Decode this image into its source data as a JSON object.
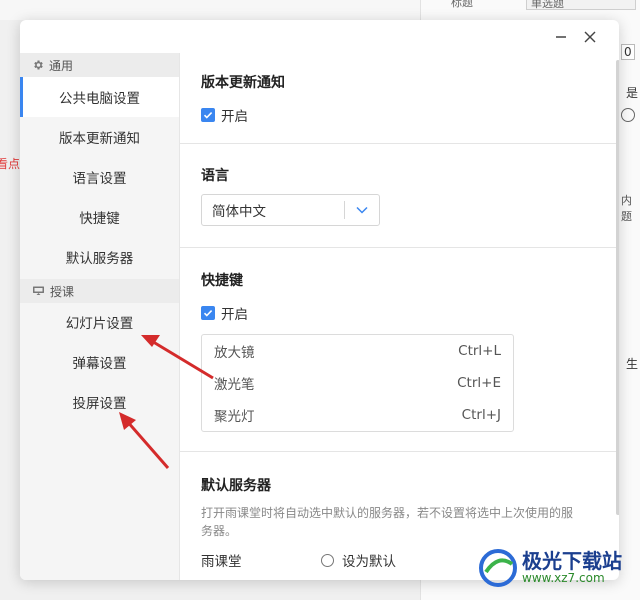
{
  "background_app": {
    "hint_text": "看点",
    "top_label": "标题",
    "top_box": "单选题",
    "spin_value": "0",
    "right_text_1": "是",
    "right_text_2": "内题",
    "right_text_3": "生"
  },
  "dialog": {
    "window": {
      "minimize_symbol": "—",
      "close_symbol": "✕"
    },
    "sidebar": {
      "groups": [
        {
          "header": "通用",
          "icon": "gear-icon",
          "items": [
            "公共电脑设置",
            "版本更新通知",
            "语言设置",
            "快捷键",
            "默认服务器"
          ]
        },
        {
          "header": "授课",
          "icon": "projector-icon",
          "items": [
            "幻灯片设置",
            "弹幕设置",
            "投屏设置"
          ]
        }
      ],
      "active_item": "公共电脑设置"
    },
    "content": {
      "update_notice": {
        "title": "版本更新通知",
        "checkbox_label": "开启",
        "checked": true
      },
      "language": {
        "title": "语言",
        "selected": "简体中文"
      },
      "shortcuts": {
        "title": "快捷键",
        "checkbox_label": "开启",
        "checked": true,
        "rows": [
          {
            "name": "放大镜",
            "key": "Ctrl+L"
          },
          {
            "name": "激光笔",
            "key": "Ctrl+E"
          },
          {
            "name": "聚光灯",
            "key": "Ctrl+J"
          }
        ]
      },
      "default_server": {
        "title": "默认服务器",
        "description": "打开雨课堂时将自动选中默认的服务器，若不设置将选中上次使用的服务器。",
        "servers": [
          {
            "name": "雨课堂",
            "action": "设为默认"
          }
        ]
      }
    }
  },
  "watermark": {
    "name": "极光下载站",
    "url": "www.xz7.com"
  },
  "colors": {
    "accent": "#3a86f0",
    "arrow": "#d42b2b",
    "sidebar_bg": "#f5f5f5"
  }
}
